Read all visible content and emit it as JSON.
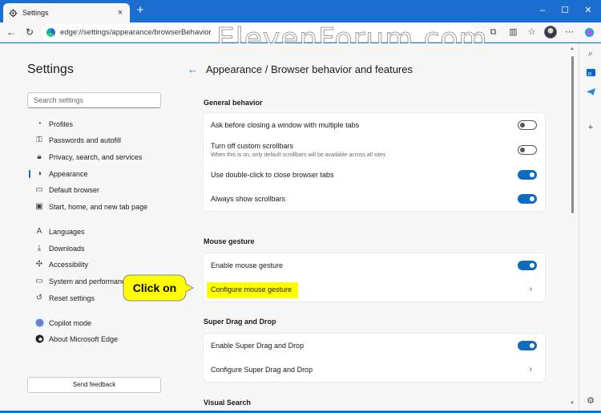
{
  "window": {
    "tab_title": "Settings",
    "url": "edge://settings/appearance/browserBehavior"
  },
  "watermark": "ElevenForum.com",
  "sidebar": {
    "title": "Settings",
    "search_placeholder": "Search settings",
    "items": [
      {
        "label": "Profiles",
        "icon": "profile-icon"
      },
      {
        "label": "Passwords and autofill",
        "icon": "key-icon"
      },
      {
        "label": "Privacy, search, and services",
        "icon": "lock-icon"
      },
      {
        "label": "Appearance",
        "icon": "appearance-icon",
        "active": true
      },
      {
        "label": "Default browser",
        "icon": "browser-icon"
      },
      {
        "label": "Start, home, and new tab page",
        "icon": "home-icon"
      },
      {
        "label": "Languages",
        "icon": "languages-icon"
      },
      {
        "label": "Downloads",
        "icon": "download-icon"
      },
      {
        "label": "Accessibility",
        "icon": "accessibility-icon"
      },
      {
        "label": "System and performance",
        "icon": "system-icon"
      },
      {
        "label": "Reset settings",
        "icon": "reset-icon"
      },
      {
        "label": "Copilot mode",
        "icon": "copilot-icon"
      },
      {
        "label": "About Microsoft Edge",
        "icon": "edge-icon"
      }
    ],
    "feedback_label": "Send feedback"
  },
  "main": {
    "title": "Appearance / Browser behavior and features",
    "sections": [
      {
        "heading": "General behavior",
        "rows": [
          {
            "label": "Ask before closing a window with multiple tabs",
            "control": "toggle",
            "on": false
          },
          {
            "label": "Turn off custom scrollbars",
            "sub": "When this is on, only default scrollbars will be available across all sites",
            "control": "toggle",
            "on": false
          },
          {
            "label": "Use double-click to close browser tabs",
            "control": "toggle",
            "on": true
          },
          {
            "label": "Always show scrollbars",
            "control": "toggle",
            "on": true
          }
        ]
      },
      {
        "heading": "Mouse gesture",
        "rows": [
          {
            "label": "Enable mouse gesture",
            "control": "toggle",
            "on": true
          },
          {
            "label": "Configure mouse gesture",
            "control": "chevron",
            "highlighted": true
          }
        ]
      },
      {
        "heading": "Super Drag and Drop",
        "rows": [
          {
            "label": "Enable Super Drag and Drop",
            "control": "toggle",
            "on": true
          },
          {
            "label": "Configure Super Drag and Drop",
            "control": "chevron"
          }
        ]
      },
      {
        "heading": "Visual Search",
        "rows": []
      }
    ]
  },
  "callout": {
    "text": "Click on",
    "color": "#ffff00"
  },
  "colors": {
    "accent": "#0f6cbd",
    "titlebar": "#1c6fd1"
  }
}
